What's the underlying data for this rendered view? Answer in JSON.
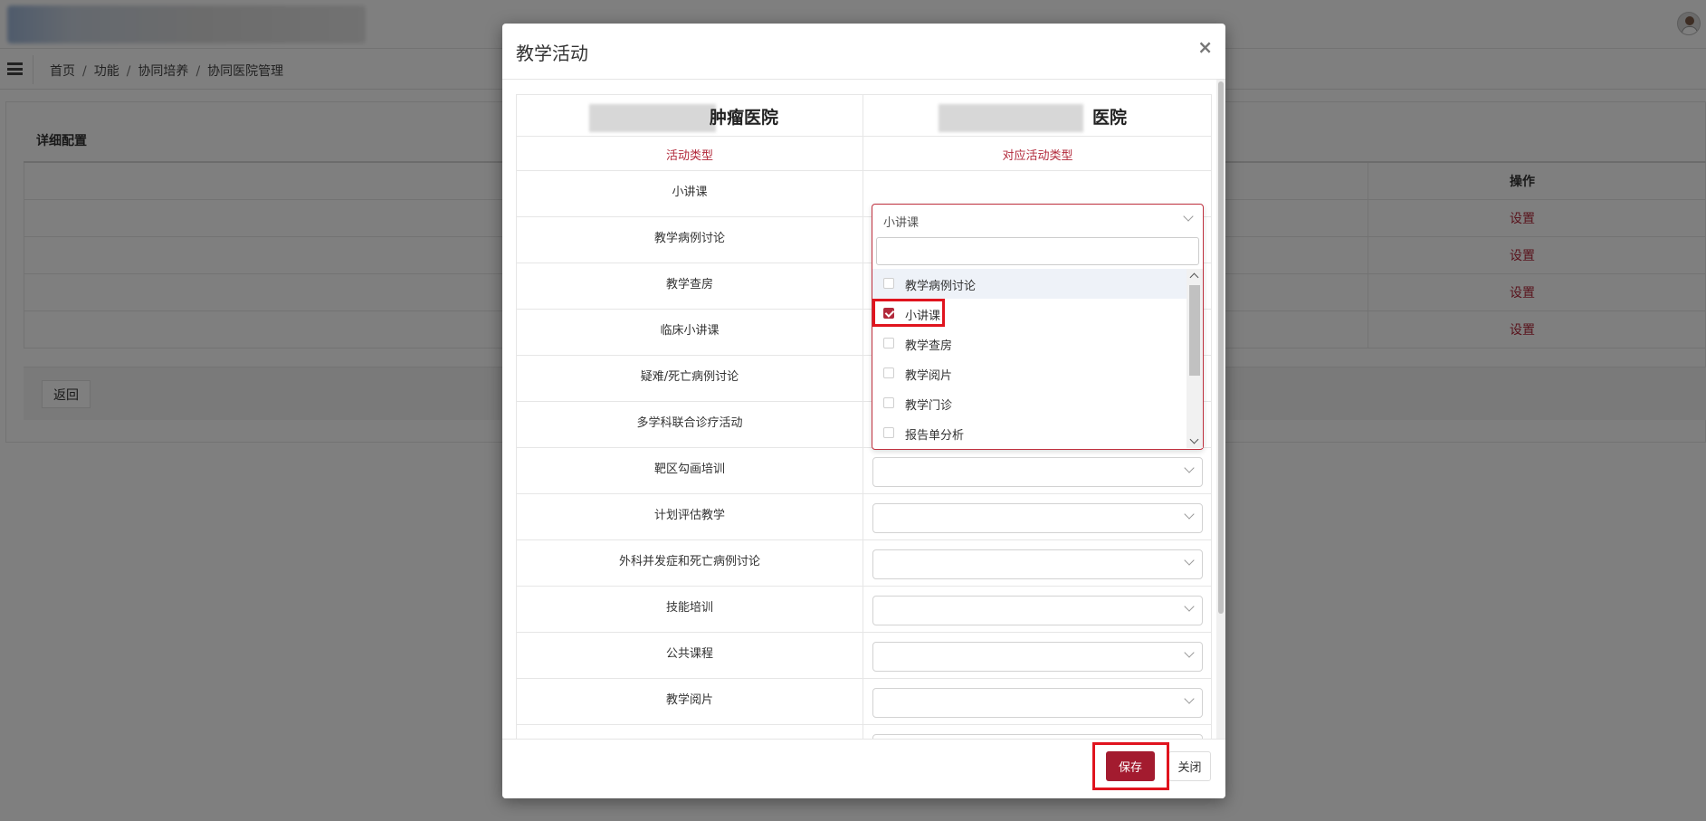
{
  "breadcrumb": [
    "首页",
    "功能",
    "协同培养",
    "协同医院管理"
  ],
  "card": {
    "title": "详细配置",
    "op_header": "操作",
    "rows": [
      {
        "action": "设置"
      },
      {
        "action": "设置"
      },
      {
        "action": "设置"
      },
      {
        "action": "设置"
      }
    ],
    "back_label": "返回"
  },
  "modal": {
    "title": "教学活动",
    "close_glyph": "×",
    "left_hospital": "肿瘤医院",
    "right_hospital": "医院",
    "left_header": "活动类型",
    "right_header": "对应活动类型",
    "activities": [
      {
        "name": "小讲课",
        "selected": "小讲课"
      },
      {
        "name": "教学病例讨论",
        "selected": ""
      },
      {
        "name": "教学查房",
        "selected": ""
      },
      {
        "name": "临床小讲课",
        "selected": ""
      },
      {
        "name": "疑难/死亡病例讨论",
        "selected": ""
      },
      {
        "name": "多学科联合诊疗活动",
        "selected": ""
      },
      {
        "name": "靶区勾画培训",
        "selected": ""
      },
      {
        "name": "计划评估教学",
        "selected": ""
      },
      {
        "name": "外科并发症和死亡病例讨论",
        "selected": ""
      },
      {
        "name": "技能培训",
        "selected": ""
      },
      {
        "name": "公共课程",
        "selected": ""
      },
      {
        "name": "教学阅片",
        "selected": ""
      }
    ],
    "dropdown": {
      "selected_text": "小讲课",
      "search_value": "",
      "options": [
        {
          "label": "教学病例讨论",
          "checked": false
        },
        {
          "label": "小讲课",
          "checked": true
        },
        {
          "label": "教学查房",
          "checked": false
        },
        {
          "label": "教学阅片",
          "checked": false
        },
        {
          "label": "教学门诊",
          "checked": false
        },
        {
          "label": "报告单分析",
          "checked": false
        }
      ]
    },
    "save_label": "保存",
    "close_label": "关闭"
  },
  "colors": {
    "accent": "#a31b2f",
    "link_red": "#b2293b",
    "highlight_frame": "#e0141e"
  },
  "icons": [
    "menu-icon",
    "user-avatar",
    "close-icon",
    "chevron-down-icon",
    "checkbox-icon",
    "scroll-up-icon",
    "scroll-down-icon"
  ]
}
